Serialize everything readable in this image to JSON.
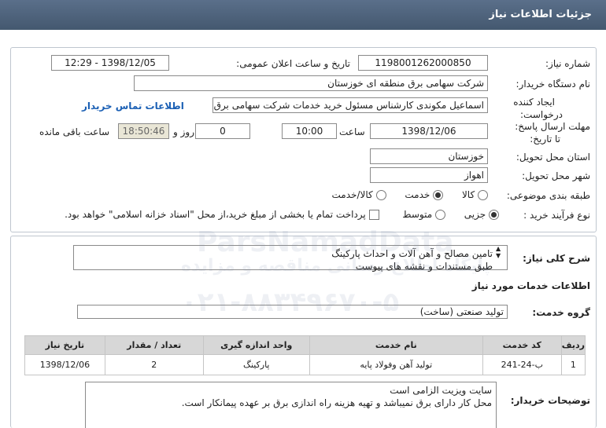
{
  "header": {
    "title": "جزئیات اطلاعات نیاز"
  },
  "need": {
    "number_label": "شماره نیاز:",
    "number": "1198001262000850",
    "announce_label": "تاریخ و ساعت اعلان عمومی:",
    "announce": "1398/12/05 - 12:29",
    "buyer_label": "نام دستگاه خریدار:",
    "buyer": "شرکت سهامی برق منطقه ای خوزستان",
    "creator_label_1": "ایجاد کننده",
    "creator_label_2": "درخواست:",
    "creator": "اسماعیل مکوندی کارشناس مسئول خرید خدمات شرکت سهامی برق منطقه ای",
    "contact_link": "اطلاعات تماس خریدار",
    "deadline_label_1": "مهلت ارسال پاسخ:",
    "deadline_label_2": "تا تاریخ:",
    "deadline_date": "1398/12/06",
    "time_label": "ساعت",
    "deadline_time": "10:00",
    "days": "0",
    "days_label": "روز و",
    "remaining": "18:50:46",
    "remaining_label": "ساعت باقی مانده",
    "province_label": "استان محل تحویل:",
    "province": "خوزستان",
    "city_label": "شهر محل تحویل:",
    "city": "اهواز",
    "category_label": "طبقه بندی موضوعی:",
    "category_options": [
      "کالا",
      "خدمت",
      "کالا/خدمت"
    ],
    "process_label": "نوع فرآیند خرید :",
    "process_options": [
      "جزیی",
      "متوسط"
    ],
    "payment_note": "پرداخت تمام یا بخشی از مبلغ خرید،از محل \"اسناد خزانه اسلامی\" خواهد بود."
  },
  "summary": {
    "label": "شرح کلی نیاز:",
    "text": "تامین مصالح و آهن آلات و احداث پارکینگ\nطبق مستندات و نقشه های  پیوست"
  },
  "services": {
    "section_title": "اطلاعات خدمات مورد نیاز",
    "group_label": "گروه خدمت:",
    "group_value": "تولید صنعتی (ساخت)",
    "columns": [
      "ردیف",
      "کد خدمت",
      "نام خدمت",
      "واحد اندازه گیری",
      "تعداد / مقدار",
      "تاریخ نیاز"
    ],
    "rows": [
      [
        "1",
        "ب-24-241",
        "تولید آهن وفولاد پایه",
        "پارکینگ",
        "2",
        "1398/12/06"
      ]
    ]
  },
  "buyer_notes": {
    "label": "توضیحات خریدار:",
    "text": "سایت ویزیت الزامی است\nمحل کار دارای برق نمیباشد و تهیه هزینه راه اندازی برق بر عهده پیمانکار است."
  },
  "watermark": {
    "brand": "ParsNamadData",
    "line1": "پایگاه اطلاع رسانی مناقصه و مزایده",
    "phone": "۰۲۱-۸۸۳۴۹۶۷۰-۵"
  }
}
